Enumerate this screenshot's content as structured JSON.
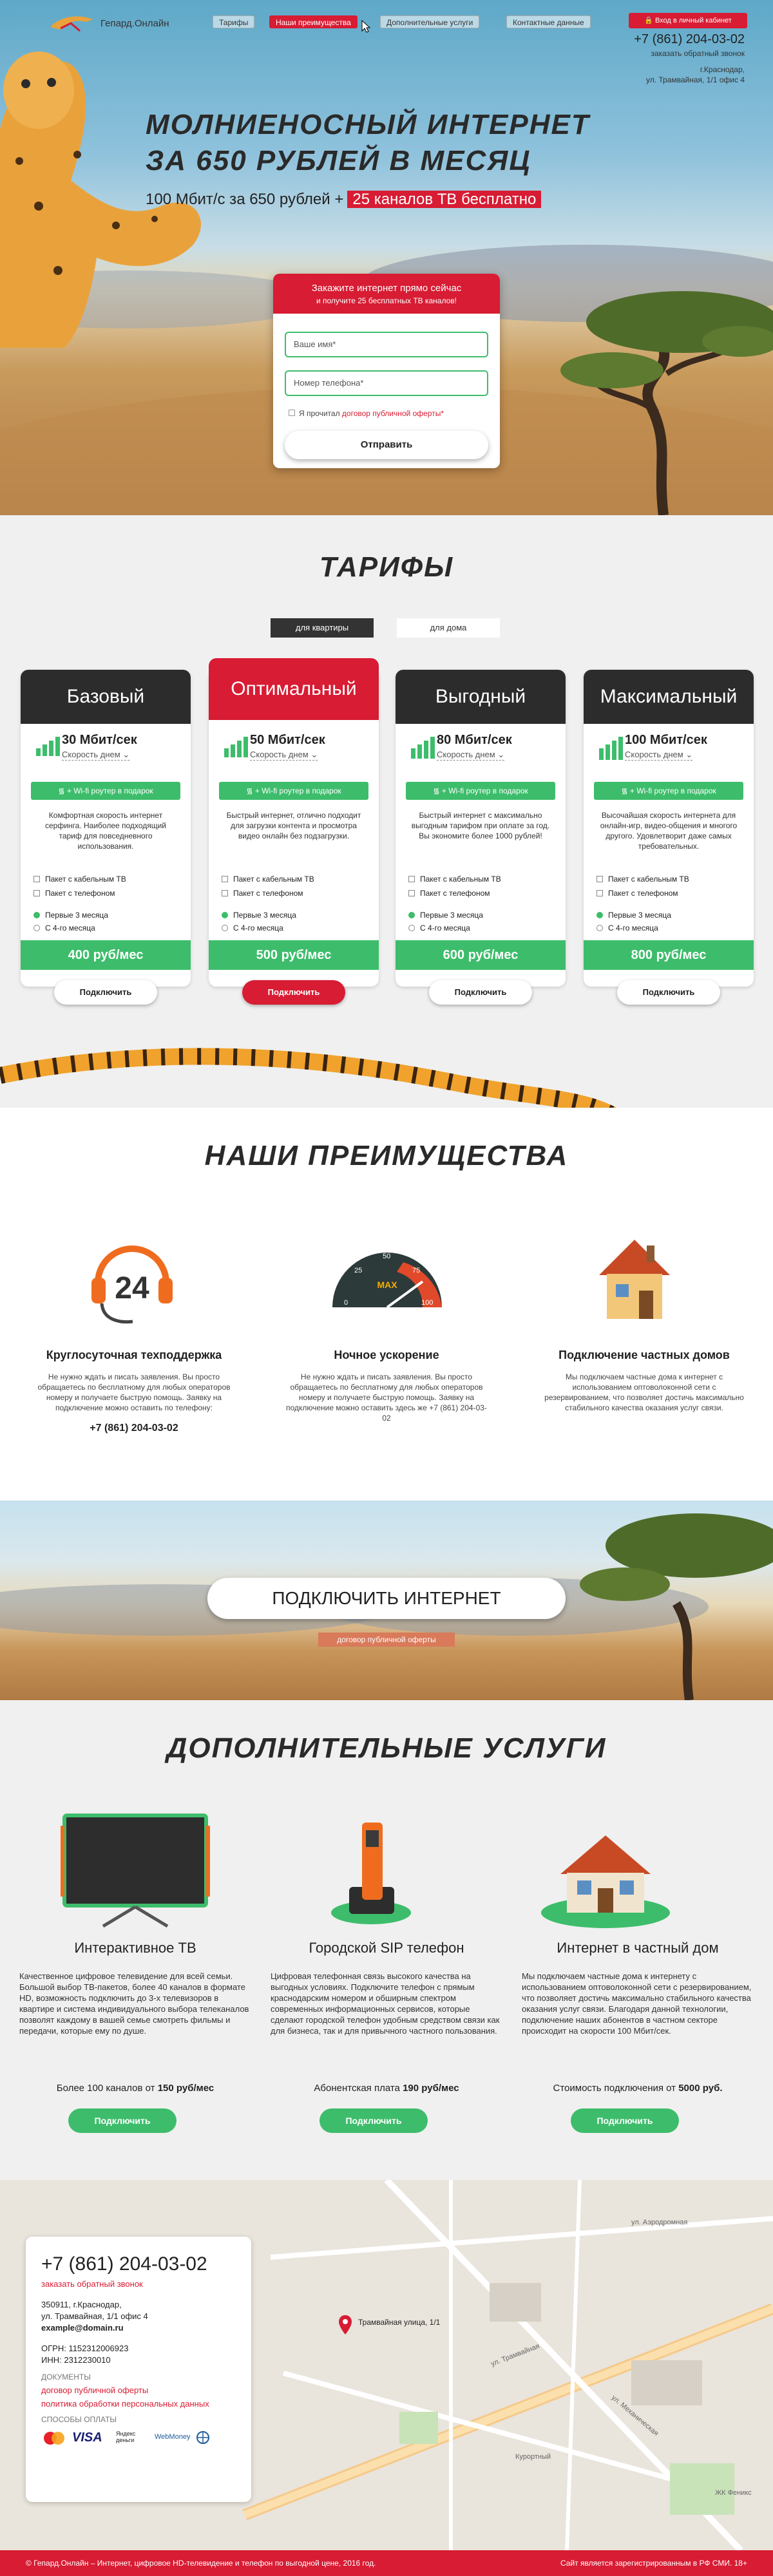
{
  "header": {
    "logo_text": "Гепард.Онлайн",
    "menu": [
      "Тарифы",
      "Наши преимущества",
      "Дополнительные услуги",
      "Контактные данные"
    ],
    "active_menu": "Наши преимущества",
    "cabinet": "Вход в личный кабинет",
    "phone": "+7 (861) 204-03-02",
    "callback": "заказать обратный звонок",
    "address_line1": "г.Краснодар,",
    "address_line2": "ул. Трамвайная, 1/1 офис 4"
  },
  "hero": {
    "title_line1": "МОЛНИЕНОСНЫЙ ИНТЕРНЕТ",
    "title_line2": "ЗА 650 РУБЛЕЙ В МЕСЯЦ",
    "subtitle": "100 Мбит/с за 650 рублей +",
    "subtitle_highlight": "25 каналов ТВ бесплатно"
  },
  "form": {
    "heading": "Закажите интернет прямо сейчас",
    "subheading": "и получите 25 бесплатных ТВ каналов!",
    "name_placeholder": "Ваше имя*",
    "phone_placeholder": "Номер телефона*",
    "agree_text": "Я прочитал",
    "agree_link": "договор публичной оферты*",
    "submit": "Отправить"
  },
  "tariffs": {
    "title": "ТАРИФЫ",
    "tab_flat": "для квартиры",
    "tab_house": "для дома",
    "speed_label": "Скорость днем",
    "wifi": "+ Wi-fi роутер в подарок",
    "opt_cable": "Пакет с кабельным ТВ",
    "opt_phone": "Пакет с телефоном",
    "opt_first3": "Первые 3 месяца",
    "opt_from4": "С 4-го месяца",
    "connect": "Подключить",
    "cards": [
      {
        "name": "Базовый",
        "speed": "30 Мбит/сек",
        "desc": "Комфортная скорость интернет серфинга. Наиболее подходящий тариф для повседневного использования.",
        "price": "400 руб/мес"
      },
      {
        "name": "Оптимальный",
        "speed": "50 Мбит/сек",
        "desc": "Быстрый интернет, отлично подходит для загрузки контента и просмотра видео онлайн без подзагрузки.",
        "price": "500 руб/мес"
      },
      {
        "name": "Выгодный",
        "speed": "80 Мбит/сек",
        "desc": "Быстрый интернет с максимально выгодным тарифом при оплате за год. Вы экономите более 1000 рублей!",
        "price": "600 руб/мес"
      },
      {
        "name": "Максимальный",
        "speed": "100 Мбит/сек",
        "desc": "Высочайшая скорость интернета для онлайн-игр, видео-общения и многого другого. Удовлетворит даже самых требовательных.",
        "price": "800 руб/мес"
      }
    ]
  },
  "advantages": {
    "title": "НАШИ ПРЕИМУЩЕСТВА",
    "support_number": "24",
    "gauge_label": "MAX",
    "gauge_ticks": [
      "0",
      "25",
      "50",
      "75",
      "100"
    ],
    "items": [
      {
        "title": "Круглосуточная техподдержка",
        "text": "Не нужно ждать и писать заявления. Вы просто обращаетесь по бесплатному для любых операторов номеру и получаете быструю помощь. Заявку на подключение можно оставить по телефону:",
        "phone": "+7 (861) 204-03-02"
      },
      {
        "title": "Ночное ускорение",
        "text": "Не нужно ждать и писать заявления. Вы просто обращаетесь по бесплатному для любых операторов номеру и получаете быструю помощь. Заявку на подключение можно оставить здесь же +7 (861) 204-03-02"
      },
      {
        "title": "Подключение частных домов",
        "text": "Мы подключаем частные дома к интернет с использованием оптоволоконной сети с резервированием, что позволяет достичь максимально стабильного качества оказания услуг связи."
      }
    ]
  },
  "banner": {
    "button": "ПОДКЛЮЧИТЬ ИНТЕРНЕТ",
    "link": "договор публичной оферты"
  },
  "services": {
    "title": "ДОПОЛНИТЕЛЬНЫЕ УСЛУГИ",
    "button": "Подключить",
    "items": [
      {
        "title": "Интерактивное ТВ",
        "text": "Качественное цифровое телевидение для всей семьи. Большой выбор ТВ-пакетов, более 40 каналов в формате HD, возможность подключить до 3-х телевизоров в квартире и система индивидуального выбора телеканалов позволят каждому в вашей семье смотреть фильмы и передачи, которые ему по душе.",
        "price_prefix": "Более 100 каналов от",
        "price_value": "150 руб/мес"
      },
      {
        "title": "Городской SIP телефон",
        "text": "Цифровая телефонная связь высокого качества на выгодных условиях. Подключите телефон с прямым краснодарским номером и обширным спектром современных информационных сервисов, которые сделают городской телефон удобным средством связи как для бизнеса, так и для привычного частного пользования.",
        "price_prefix": "Абонентская плата",
        "price_value": "190 руб/мес"
      },
      {
        "title": "Интернет в частный дом",
        "text": "Мы подключаем частные дома к интернету с использованием оптоволоконной сети с резервированием, что позволяет достичь максимально стабильного качества оказания услуг связи. Благодаря данной технологии, подключение наших абонентов в частном секторе происходит на скорости 100 Мбит/сек.",
        "price_prefix": "Стоимость подключения от",
        "price_value": "5000 руб."
      }
    ]
  },
  "contacts": {
    "phone": "+7 (861) 204-03-02",
    "callback": "заказать обратный звонок",
    "addr1": "350911, г.Краснодар,",
    "addr2": "ул. Трамвайная, 1/1 офис 4",
    "email": "example@domain.ru",
    "ogrn": "ОГРН: 1152312006923",
    "inn": "ИНН: 2312230010",
    "docs_label": "ДОКУМЕНТЫ",
    "doc1": "договор публичной оферты",
    "doc2": "политика обработки персональных данных",
    "pay_label": "СПОСОБЫ ОПЛАТЫ",
    "pay_visa": "VISA",
    "pay_yandex": "Яндекс деньги",
    "pay_webmoney": "WebMoney",
    "map_label": "Трамвайная улица, 1/1",
    "street1": "ул. Трамвайная",
    "street2": "ул. Аэродромная",
    "street3": "Курортный",
    "street4": "ул. Механическая",
    "street5": "ЖК Феникс"
  },
  "footer": {
    "left": "© Гепард.Онлайн – Интернет, цифровое HD-телевидение и телефон по выгодной цене, 2016 год.",
    "right": "Сайт является зарегистрированным в РФ СМИ. 18+"
  },
  "colors": {
    "brand_red": "#d71c33",
    "brand_green": "#3dbd6b",
    "dark": "#2c2c2c"
  }
}
